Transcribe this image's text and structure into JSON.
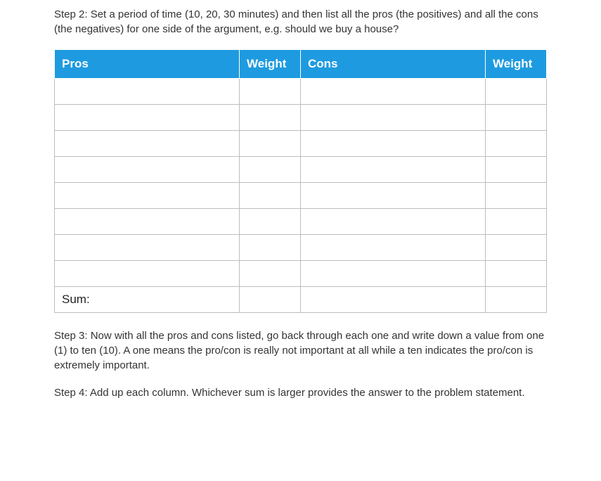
{
  "steps": {
    "step2": "Step 2: Set a period of time (10, 20, 30 minutes) and then list all the pros (the positives) and all the cons (the negatives) for one side of the argument, e.g. should we buy a house?",
    "step3": "Step 3: Now with all the pros and cons listed, go back through each one and write down a value from one (1) to ten (10). A one means the pro/con is really not important at all while a ten indicates the pro/con is extremely important.",
    "step4": "Step 4: Add up each column. Whichever sum is larger provides the answer to the problem statement."
  },
  "table": {
    "headers": {
      "pros": "Pros",
      "weight1": "Weight",
      "cons": "Cons",
      "weight2": "Weight"
    },
    "blank_rows": 8,
    "sum_label": "Sum:"
  },
  "colors": {
    "header_bg": "#1E9BE0",
    "header_fg": "#ffffff",
    "cell_border": "#bdbdbd",
    "text": "#333333"
  }
}
